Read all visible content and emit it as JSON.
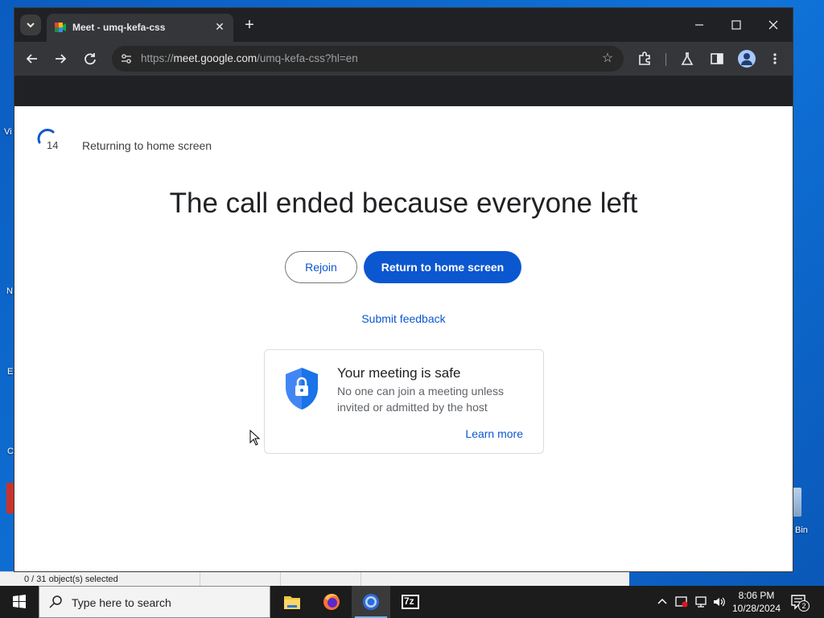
{
  "browser": {
    "tab_title": "Meet - umq-kefa-css",
    "url_scheme": "https://",
    "url_host": "meet.google.com",
    "url_path": "/umq-kefa-css?hl=en",
    "icons": {
      "tab_search": "chevron-down-icon",
      "tab_close": "close-icon",
      "new_tab": "plus-icon",
      "back": "arrow-left-icon",
      "forward": "arrow-right-icon",
      "reload": "reload-icon",
      "site_info": "tune-icon",
      "bookmark": "star-icon",
      "extensions": "puzzle-icon",
      "labs": "flask-icon",
      "side_panel": "side-panel-icon",
      "profile": "avatar-icon",
      "menu": "kebab-menu-icon"
    }
  },
  "meet": {
    "countdown_number": "14",
    "returning_text": "Returning to home screen",
    "headline": "The call ended because everyone left",
    "rejoin_label": "Rejoin",
    "return_label": "Return to home screen",
    "feedback_label": "Submit feedback",
    "safe_card": {
      "title": "Your meeting is safe",
      "text": "No one can join a meeting unless invited or admitted by the host",
      "learn_more": "Learn more"
    },
    "colors": {
      "accent": "#0b57d0",
      "text": "#202124",
      "shield": "#4285f4"
    }
  },
  "explorer_status": "0 / 31 object(s) selected",
  "desktop": {
    "fragments": [
      "Vi",
      "N",
      "E",
      "C",
      "Bin"
    ]
  },
  "taskbar": {
    "search_placeholder": "Type here to search",
    "apps": [
      "file-explorer-icon",
      "firefox-icon",
      "chrome-icon",
      "7zip-icon"
    ],
    "app_7z_label": "7z",
    "time": "8:06 PM",
    "date": "10/28/2024",
    "notification_count": "2"
  }
}
